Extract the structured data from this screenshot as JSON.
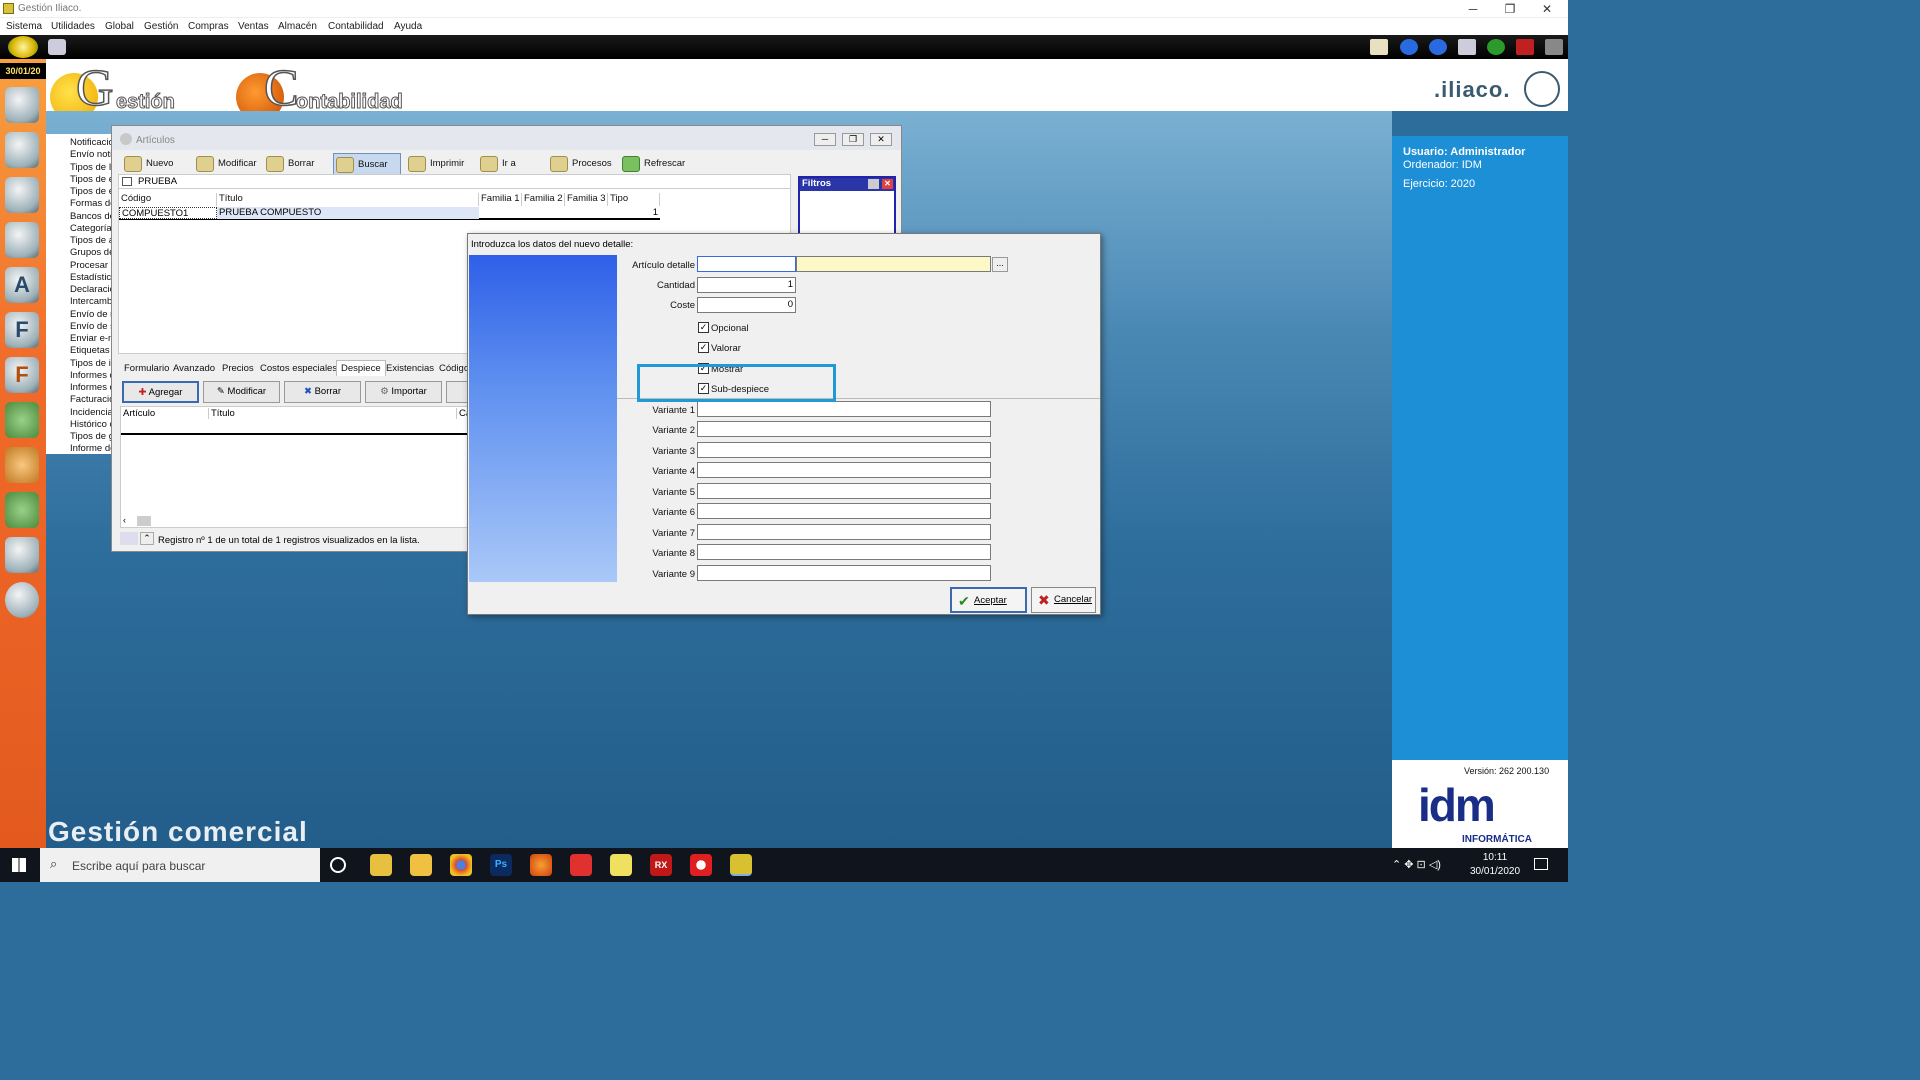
{
  "window": {
    "title": "Gestión Iliaco."
  },
  "menu": [
    "Sistema",
    "Utilidades",
    "Global",
    "Gestión",
    "Compras",
    "Ventas",
    "Almacén",
    "Contabilidad",
    "Ayuda"
  ],
  "sidebar": {
    "date": "30/01/20",
    "letters": [
      "A",
      "F",
      "F"
    ]
  },
  "header": {
    "gestion_text": "estión",
    "contabilidad_text": "ontabilidad",
    "logo_text": ".iliaco."
  },
  "user_panel": {
    "usuario": "Usuario: Administrador",
    "ordenador": "Ordenador: IDM",
    "ejercicio": "Ejercicio: 2020",
    "version": "Versión: 262 200.130",
    "idm": "idm",
    "informatica": "INFORMÁTICA"
  },
  "status_list": [
    "Notificacio",
    "Envío noti",
    "Tipos de I",
    "Tipos de e",
    "Tipos de e",
    "Formas de",
    "Bancos de",
    "Categoría",
    "Tipos de a",
    "Grupos de",
    "Procesar l",
    "Estadístic",
    "Declaracio",
    "Intercambi",
    "Envío de r",
    "Envío de s",
    "Enviar e-m",
    "Etiquetas",
    "Tipos de in",
    "Informes d",
    "Informes d",
    "Facturació",
    "Incidencia",
    "Histórico d",
    "Tipos de g",
    "Informe de"
  ],
  "bottom_title": "Gestión comercial",
  "articulos": {
    "title": "Artículos",
    "toolbar": [
      "Nuevo",
      "Modificar",
      "Borrar",
      "Buscar",
      "Imprimir",
      "Ir a",
      "Procesos",
      "Refrescar"
    ],
    "filter_label": "PRUEBA",
    "columns": [
      "Código",
      "Título",
      "Familia 1",
      "Familia 2",
      "Familia 3",
      "Tipo"
    ],
    "row": {
      "codigo": "COMPUESTO1",
      "titulo": "PRUEBA COMPUESTO",
      "tipo": "1"
    },
    "filtros": "Filtros",
    "tabs": [
      "Formulario",
      "Avanzado",
      "Precios",
      "Costos especiales",
      "Despiece",
      "Existencias",
      "Códigos"
    ],
    "sub_buttons": [
      "Agregar",
      "Modificar",
      "Borrar",
      "Importar"
    ],
    "sub_columns": [
      "Artículo",
      "Título",
      "Ca"
    ],
    "status": "Registro nº 1 de un total de 1 registros visualizados en la lista."
  },
  "dialog": {
    "title": "Introduzca los datos del nuevo detalle:",
    "articulo_label": "Artículo detalle",
    "cantidad_label": "Cantidad",
    "cantidad_value": "1",
    "coste_label": "Coste",
    "coste_value": "0",
    "checks": [
      "Opcional",
      "Valorar",
      "Mostrar",
      "Sub-despiece"
    ],
    "variantes": [
      "Variante 1",
      "Variante 2",
      "Variante 3",
      "Variante 4",
      "Variante 5",
      "Variante 6",
      "Variante 7",
      "Variante 8",
      "Variante 9"
    ],
    "ok": "Aceptar",
    "cancel": "Cancelar",
    "browse": "..."
  },
  "taskbar": {
    "search_placeholder": "Escribe aquí para buscar",
    "time": "10:11",
    "date": "30/01/2020"
  },
  "colors": {
    "accent": "#1f9ad6",
    "desktop": "#2d6d9c",
    "sidebar": "#f06a2a"
  }
}
